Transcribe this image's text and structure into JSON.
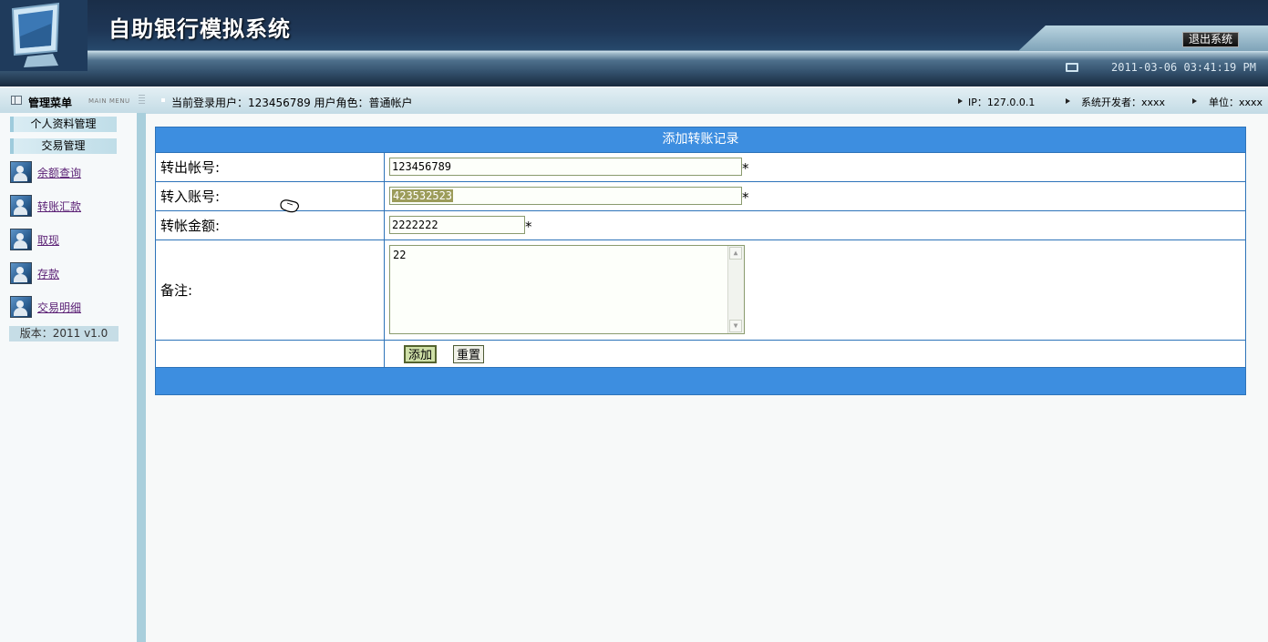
{
  "app": {
    "title": "自助银行模拟系统",
    "logout_label": "退出系统",
    "datetime": "2011-03-06 03:41:19 PM"
  },
  "infobar": {
    "menu_label": "管理菜单",
    "menu_sub": "MAIN MENU",
    "user_info": "当前登录用户：123456789  用户角色：普通帐户",
    "ip": "IP：127.0.0.1",
    "developer": "系统开发者：xxxx",
    "unit": "单位：xxxx"
  },
  "sidebar": {
    "sections": [
      "个人资料管理",
      "交易管理"
    ],
    "items": [
      {
        "label": "余额查询",
        "icon": "user-icon"
      },
      {
        "label": "转账汇款",
        "icon": "user-icon"
      },
      {
        "label": "取现",
        "icon": "user-icon"
      },
      {
        "label": "存款",
        "icon": "user-icon"
      },
      {
        "label": "交易明细",
        "icon": "user-icon"
      }
    ],
    "version": "版本：2011 v1.0"
  },
  "form": {
    "title": "添加转账记录",
    "from_label": "转出帐号:",
    "from_value": "123456789",
    "to_label": "转入账号:",
    "to_value": "423532523",
    "amount_label": "转帐金额:",
    "amount_value": "2222222",
    "remark_label": "备注:",
    "remark_value": "22",
    "required_mark": "*",
    "add_label": "添加",
    "reset_label": "重置"
  },
  "colors": {
    "header_dark": "#1e3656",
    "table_header": "#3d8ee0",
    "table_border": "#2d73b9",
    "link": "#5a1f74"
  }
}
